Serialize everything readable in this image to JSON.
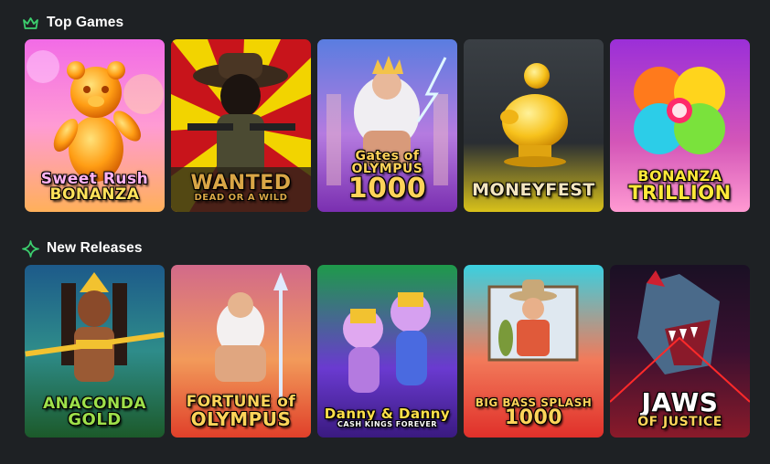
{
  "top_games": {
    "title": "Top Games",
    "icon": "crown-icon",
    "accent": "#3ccf6e",
    "games": [
      {
        "name": "sweet-rush-bonanza",
        "logo_line1": "Sweet Rush",
        "logo_line2": "BONANZA"
      },
      {
        "name": "wanted-dead-or-a-wild",
        "logo_line1": "WANTED",
        "logo_line2": "DEAD OR A WILD"
      },
      {
        "name": "gates-of-olympus-1000",
        "logo_line1": "Gates of OLYMPUS",
        "logo_line2": "1000"
      },
      {
        "name": "moneyfest",
        "logo_line1": "MONEYFEST",
        "logo_line2": ""
      },
      {
        "name": "bonanza-trillion",
        "logo_line1": "BONANZA",
        "logo_line2": "TRILLION"
      }
    ]
  },
  "new_releases": {
    "title": "New Releases",
    "icon": "sparkle-icon",
    "accent": "#3ccf6e",
    "games": [
      {
        "name": "anaconda-gold",
        "logo_line1": "ANACONDA",
        "logo_line2": "GOLD"
      },
      {
        "name": "fortune-of-olympus",
        "logo_line1": "FORTUNE of",
        "logo_line2": "OLYMPUS"
      },
      {
        "name": "danny-dollar",
        "logo_line1": "Danny & Danny",
        "logo_line2": "CASH KINGS FOREVER"
      },
      {
        "name": "big-bass-splash-1000",
        "logo_line1": "BIG BASS SPLASH",
        "logo_line2": "1000"
      },
      {
        "name": "jaws-of-justice",
        "logo_line1": "JAWS",
        "logo_line2": "OF JUSTICE"
      }
    ]
  }
}
